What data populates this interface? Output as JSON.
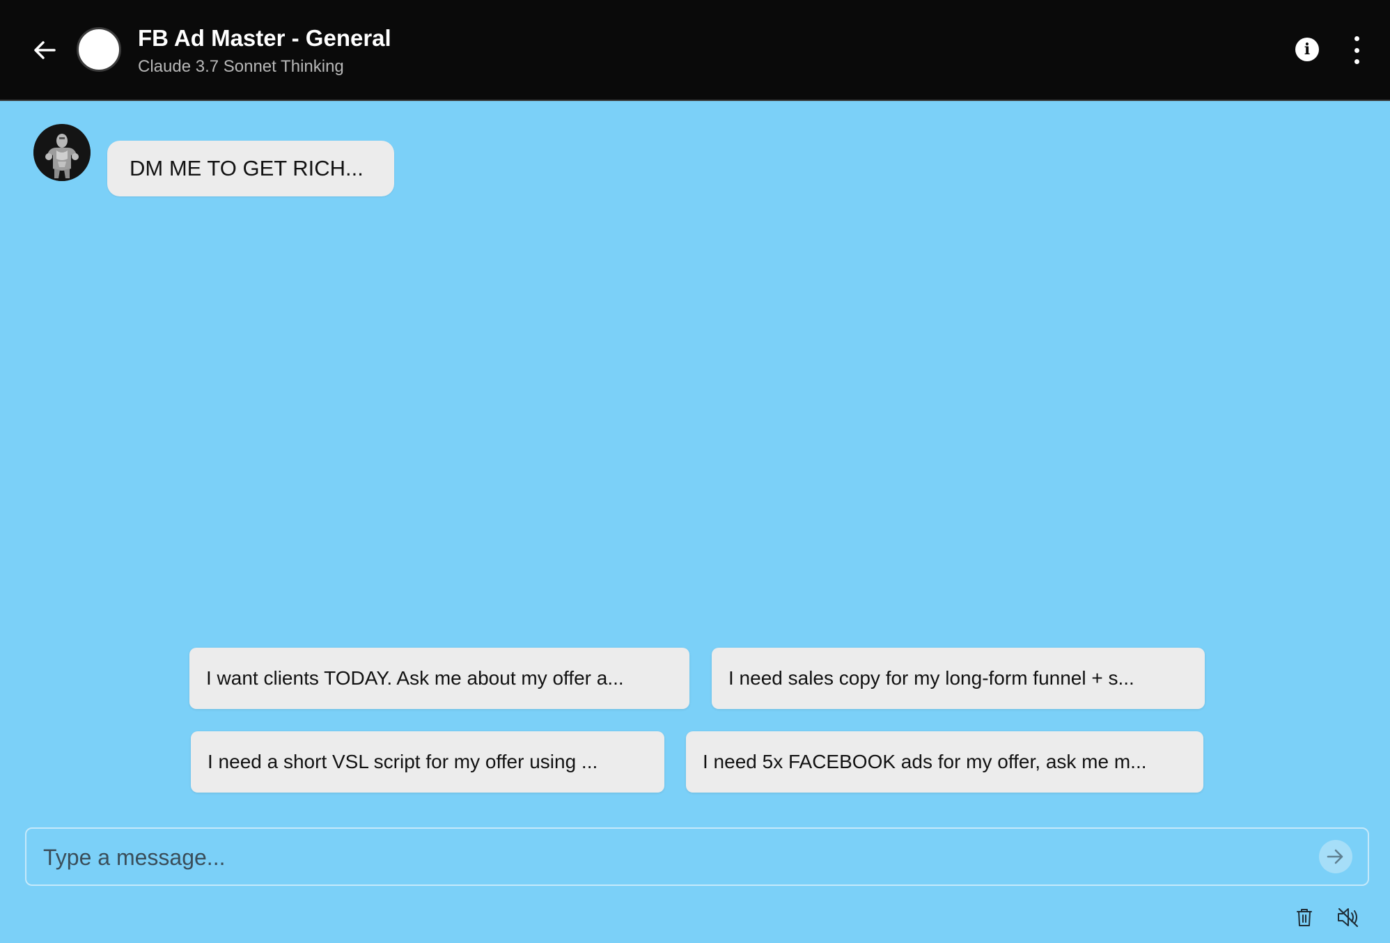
{
  "header": {
    "title": "FB Ad Master - General",
    "subtitle": "Claude 3.7 Sonnet Thinking",
    "back_icon": "arrow-left-icon",
    "info_icon": "info-icon",
    "menu_icon": "more-vertical-icon"
  },
  "messages": [
    {
      "sender": "bot",
      "avatar_icon": "robot-avatar",
      "text": "DM ME TO GET RICH..."
    }
  ],
  "suggestions": [
    {
      "label": "I want clients TODAY. Ask me about my offer a..."
    },
    {
      "label": "I need sales copy for my long-form funnel + s..."
    },
    {
      "label": "I need a short VSL script for my offer using ..."
    },
    {
      "label": "I need 5x FACEBOOK ads for my offer, ask me m..."
    }
  ],
  "composer": {
    "placeholder": "Type a message...",
    "value": "",
    "send_icon": "arrow-right-icon"
  },
  "footer": {
    "delete_icon": "trash-icon",
    "mute_icon": "speaker-muted-icon"
  },
  "colors": {
    "background": "#7bd0f8",
    "header": "#0a0a0a",
    "bubble": "#ececec",
    "text": "#111111"
  }
}
